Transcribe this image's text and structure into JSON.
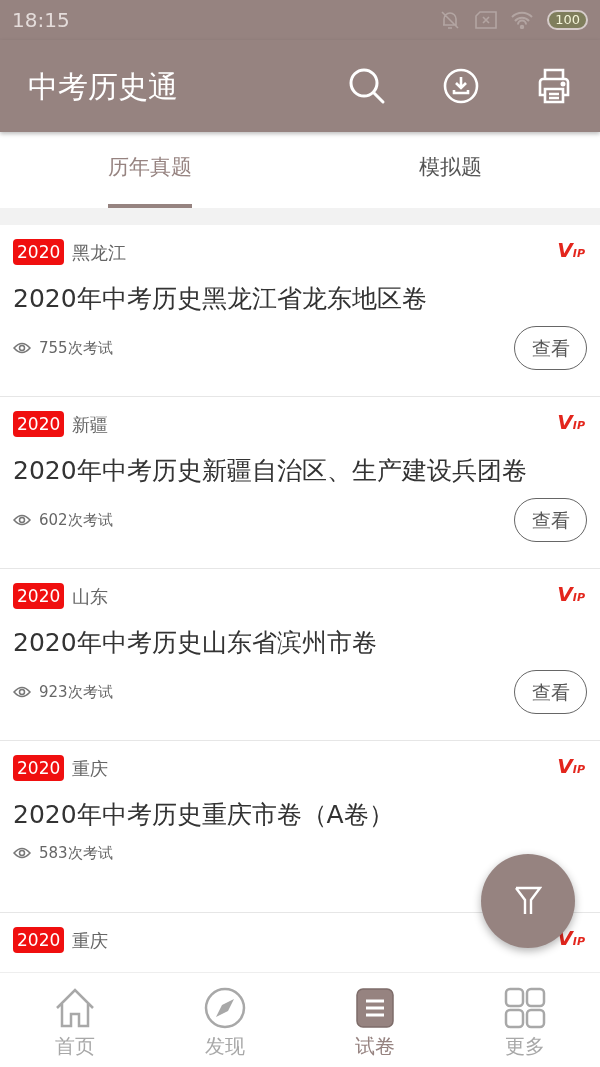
{
  "status_bar": {
    "time": "18:15",
    "battery": "100"
  },
  "header": {
    "title": "中考历史通"
  },
  "tabs": [
    {
      "label": "历年真题",
      "selected": true
    },
    {
      "label": "模拟题",
      "selected": false
    }
  ],
  "papers": [
    {
      "year": "2020",
      "region": "黑龙江",
      "badge": "VIP",
      "title": "2020年中考历史黑龙江省龙东地区卷",
      "count": "755次考试",
      "button": "查看"
    },
    {
      "year": "2020",
      "region": "新疆",
      "badge": "VIP",
      "title": "2020年中考历史新疆自治区、生产建设兵团卷",
      "count": "602次考试",
      "button": "查看"
    },
    {
      "year": "2020",
      "region": "山东",
      "badge": "VIP",
      "title": "2020年中考历史山东省滨州市卷",
      "count": "923次考试",
      "button": "查看"
    },
    {
      "year": "2020",
      "region": "重庆",
      "badge": "VIP",
      "title": "2020年中考历史重庆市卷（A卷）",
      "count": "583次考试"
    },
    {
      "year": "2020",
      "region": "重庆",
      "badge": "VIP"
    }
  ],
  "bottom_nav": [
    {
      "label": "首页",
      "selected": false
    },
    {
      "label": "发现",
      "selected": false
    },
    {
      "label": "试卷",
      "selected": true
    },
    {
      "label": "更多",
      "selected": false
    }
  ]
}
